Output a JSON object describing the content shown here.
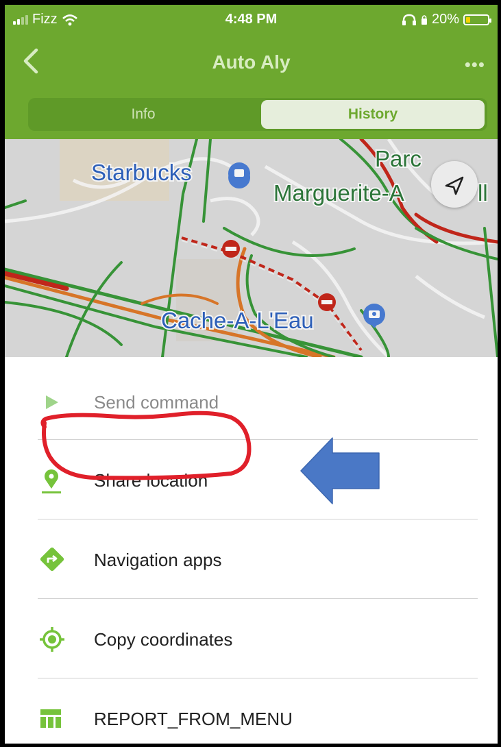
{
  "status_bar": {
    "carrier": "Fizz",
    "time": "4:48 PM",
    "battery_percent": "20%",
    "battery_level": 0.2
  },
  "header": {
    "title": "Auto Aly",
    "back_icon": "chevron-left-icon",
    "more_icon": "more-horizontal-icon",
    "more_label": "•••"
  },
  "tabs": [
    {
      "label": "Info",
      "selected": false
    },
    {
      "label": "History",
      "selected": true
    }
  ],
  "map": {
    "labels": {
      "starbucks": "Starbucks",
      "parc_line1": "Parc",
      "parc_line2": "Marguerite-A",
      "parc_line2_tail": "ll",
      "cache": "Cache-A-L'Eau"
    }
  },
  "menu": {
    "items": [
      {
        "label": "Send command",
        "icon": "play-icon",
        "enabled": false
      },
      {
        "label": "Share location",
        "icon": "location-pin-icon",
        "enabled": true
      },
      {
        "label": "Navigation apps",
        "icon": "navigation-diamond-icon",
        "enabled": true
      },
      {
        "label": "Copy coordinates",
        "icon": "target-icon",
        "enabled": true
      },
      {
        "label": "REPORT_FROM_MENU",
        "icon": "table-icon",
        "enabled": true
      }
    ]
  },
  "colors": {
    "primary_green": "#6da82f",
    "annotation_red": "#e0202a",
    "annotation_arrow_blue": "#4a78c6"
  }
}
